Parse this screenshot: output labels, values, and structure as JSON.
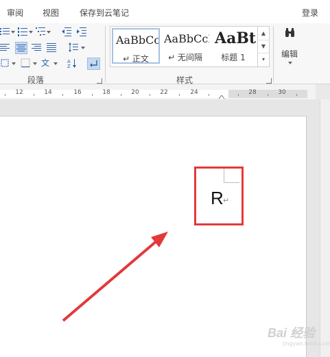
{
  "menubar": {
    "tabs": [
      "审阅",
      "视图",
      "保存到云笔记"
    ],
    "login": "登录"
  },
  "ribbon": {
    "paragraph_group_label": "段落",
    "styles_group_label": "样式",
    "styles": [
      {
        "preview": "AaBbCcI",
        "name": "↵ 正文"
      },
      {
        "preview": "AaBbCcI",
        "name": "↵ 无间隔"
      },
      {
        "preview": "AaBt",
        "name": "标题 1"
      }
    ],
    "edit_label": "编辑"
  },
  "ruler": {
    "ticks": [
      "12",
      "14",
      "16",
      "18",
      "20",
      "22",
      "24",
      "28",
      "30"
    ]
  },
  "document": {
    "char": "R",
    "paragraph_mark": "↵"
  },
  "colors": {
    "highlight_border": "#e3393a",
    "arrow": "#e3393a",
    "ribbon_accent": "#2c5fa8"
  },
  "watermark": {
    "text": "Bai 经验",
    "sub": "jingyan.baidu.com"
  }
}
